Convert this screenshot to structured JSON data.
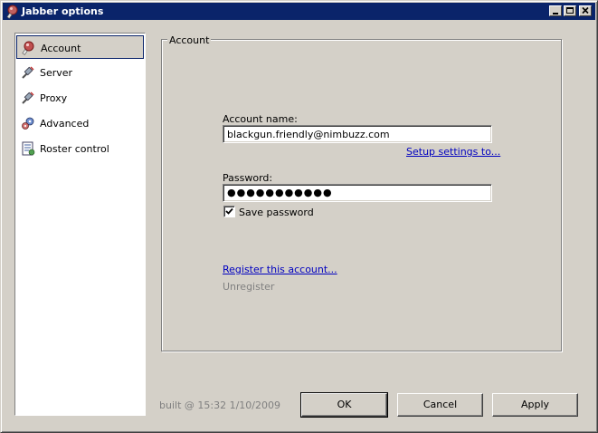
{
  "window": {
    "title": "Jabber options"
  },
  "sidebar": {
    "items": [
      {
        "label": "Account",
        "icon": "account-icon"
      },
      {
        "label": "Server",
        "icon": "server-icon"
      },
      {
        "label": "Proxy",
        "icon": "proxy-icon"
      },
      {
        "label": "Advanced",
        "icon": "advanced-icon"
      },
      {
        "label": "Roster control",
        "icon": "roster-icon"
      }
    ],
    "selected": "Account"
  },
  "account_panel": {
    "group_title": "Account",
    "account_name_label": "Account name:",
    "account_name_value": "blackgun.friendly@nimbuzz.com",
    "setup_link": "Setup settings to...",
    "password_label": "Password:",
    "password_value": "●●●●●●●●●●●",
    "save_password_label": "Save password",
    "save_password_checked": true,
    "register_link": "Register this account...",
    "unregister_label": "Unregister"
  },
  "footer": {
    "build_info": "built @ 15:32 1/10/2009",
    "ok_label": "OK",
    "cancel_label": "Cancel",
    "apply_label": "Apply"
  },
  "colors": {
    "titlebar": "#0a246a",
    "face": "#d4d0c8",
    "link": "#0000c0",
    "disabled": "#808080"
  }
}
